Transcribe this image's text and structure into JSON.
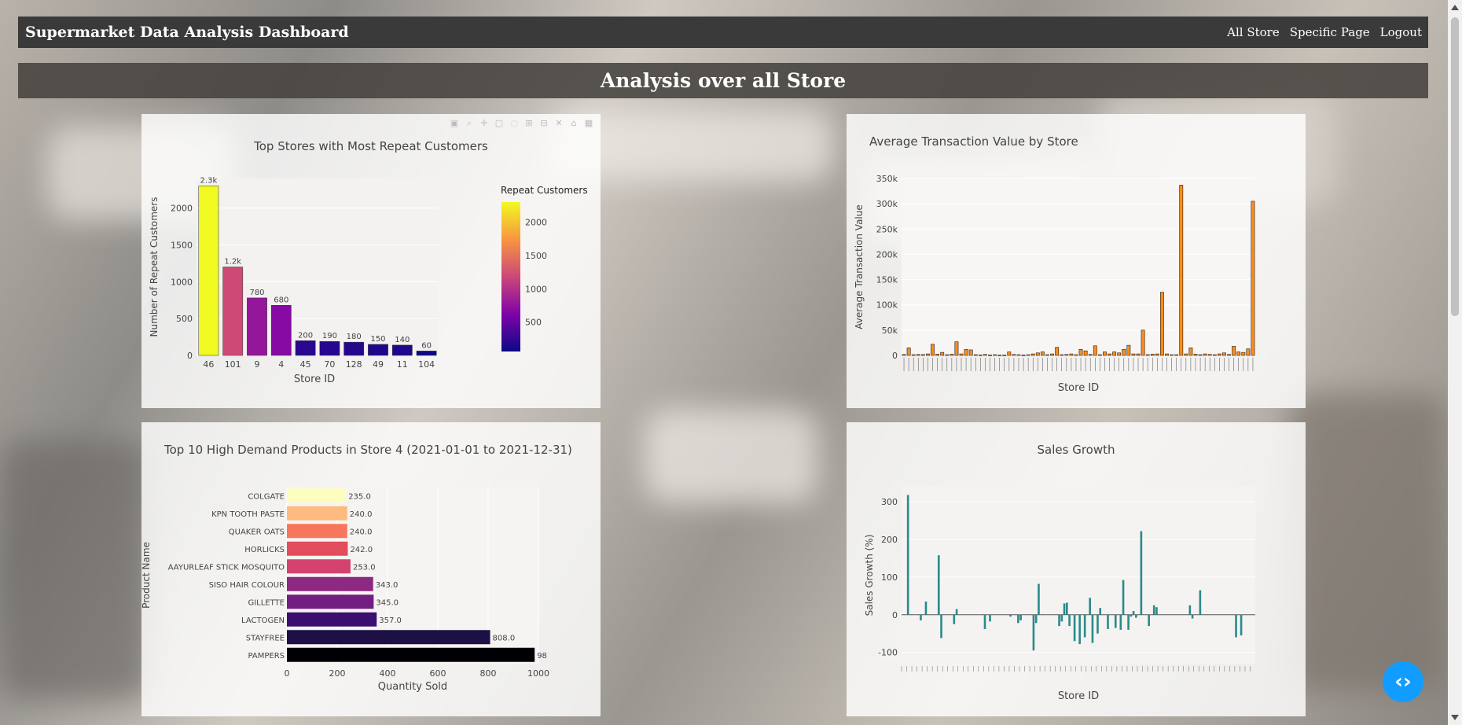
{
  "navbar": {
    "brand": "Supermarket Data Analysis Dashboard",
    "links": [
      "All Store",
      "Specific Page",
      "Logout"
    ]
  },
  "banner": {
    "title": "Analysis over all Store"
  },
  "colors": {
    "navbar": "#3a3a3a",
    "bar_orange": "#ff8c1a",
    "bar_teal": "#2a8a8a",
    "debug_button": "#119dff"
  },
  "icons": {
    "modebar": [
      "camera-icon",
      "zoom-icon",
      "pan-icon",
      "box-select-icon",
      "lasso-icon",
      "zoom-in-icon",
      "zoom-out-icon",
      "autoscale-icon",
      "reset-axes-icon",
      "plotly-logo-icon"
    ],
    "debug": "code-icon"
  },
  "chart_data": [
    {
      "type": "bar",
      "title": "Top Stores with Most Repeat Customers",
      "xlabel": "Store ID",
      "ylabel": "Number of Repeat Customers",
      "categories": [
        "46",
        "101",
        "9",
        "4",
        "45",
        "70",
        "128",
        "49",
        "11",
        "104"
      ],
      "values": [
        2300,
        1200,
        780,
        680,
        200,
        190,
        180,
        150,
        140,
        60
      ],
      "labels": [
        "2.3k",
        "1.2k",
        "780",
        "680",
        "200",
        "190",
        "180",
        "150",
        "140",
        "60"
      ],
      "ylim": [
        0,
        2400
      ],
      "yticks": [
        0,
        500,
        1000,
        1500,
        2000
      ],
      "colorbar": {
        "title": "Repeat Customers",
        "ticks": [
          500,
          1000,
          1500,
          2000
        ],
        "range": [
          60,
          2300
        ]
      }
    },
    {
      "type": "bar",
      "title": "Average Transaction Value by Store",
      "xlabel": "Store ID",
      "ylabel": "Average Transaction Value",
      "ylim": [
        0,
        350000
      ],
      "yticks": [
        0,
        50000,
        100000,
        150000,
        200000,
        250000,
        300000,
        350000
      ],
      "ytick_labels": [
        "0",
        "50k",
        "100k",
        "150k",
        "200k",
        "250k",
        "300k",
        "350k"
      ],
      "values": [
        2000,
        15000,
        1500,
        2000,
        1800,
        3000,
        22000,
        2500,
        6000,
        1500,
        2500,
        27000,
        3000,
        12000,
        11000,
        1500,
        1200,
        2000,
        1000,
        1500,
        1000,
        1000,
        7000,
        2000,
        1500,
        1000,
        1500,
        3000,
        5000,
        7000,
        1500,
        3000,
        16000,
        1500,
        2000,
        3000,
        1500,
        12000,
        9000,
        2000,
        19000,
        1500,
        7000,
        3000,
        7000,
        5000,
        12000,
        20000,
        3000,
        3000,
        50000,
        1500,
        2500,
        3000,
        125000,
        3000,
        1500,
        1500,
        337000,
        3000,
        15000,
        2500,
        1500,
        3000,
        2000,
        1500,
        3000,
        5000,
        2000,
        18000,
        7000,
        6000,
        13000,
        305000
      ]
    },
    {
      "type": "bar",
      "orientation": "horizontal",
      "title": "Top 10 High Demand Products in Store 4 (2021-01-01 to 2021-12-31)",
      "xlabel": "Quantity Sold",
      "ylabel": "Product Name",
      "categories": [
        "COLGATE",
        "KPN TOOTH PASTE",
        "QUAKER OATS",
        "HORLICKS",
        "AAYURLEAF STICK MOSQUITO",
        "SISO HAIR COLOUR",
        "GILLETTE",
        "LACTOGEN",
        "STAYFREE",
        "PAMPERS"
      ],
      "values": [
        235,
        240,
        240,
        242,
        253,
        343,
        345,
        357,
        808,
        985
      ],
      "labels": [
        "235.0",
        "240.0",
        "240.0",
        "242.0",
        "253.0",
        "343.0",
        "345.0",
        "357.0",
        "808.0",
        "98"
      ],
      "xlim": [
        0,
        1000
      ],
      "xticks": [
        0,
        200,
        400,
        600,
        800,
        1000
      ]
    },
    {
      "type": "bar",
      "title": "Sales Growth",
      "xlabel": "Store ID",
      "ylabel": "Sales Growth (%)",
      "ylim": [
        -130,
        340
      ],
      "yticks": [
        -100,
        0,
        100,
        200,
        300
      ],
      "values": [
        0,
        0,
        318,
        0,
        0,
        0,
        0,
        -15,
        0,
        35,
        0,
        0,
        0,
        0,
        158,
        -62,
        0,
        0,
        0,
        0,
        -25,
        15,
        0,
        0,
        0,
        0,
        0,
        0,
        0,
        0,
        0,
        0,
        -38,
        0,
        -18,
        0,
        0,
        0,
        0,
        0,
        0,
        0,
        -5,
        0,
        0,
        -22,
        -15,
        0,
        0,
        0,
        0,
        -95,
        -22,
        82,
        0,
        0,
        0,
        0,
        0,
        0,
        0,
        -30,
        -18,
        30,
        32,
        -30,
        0,
        -70,
        0,
        -78,
        0,
        -60,
        0,
        45,
        -75,
        0,
        -50,
        18,
        0,
        0,
        -38,
        0,
        0,
        -35,
        0,
        -40,
        92,
        0,
        -40,
        -5,
        10,
        -8,
        0,
        222,
        0,
        0,
        -30,
        0,
        25,
        20,
        0,
        0,
        0,
        0,
        0,
        0,
        0,
        0,
        0,
        0,
        0,
        0,
        25,
        -10,
        0,
        0,
        65,
        0,
        0,
        0,
        0,
        0,
        0,
        0,
        0,
        0,
        0,
        0,
        0,
        0,
        -60,
        0,
        -55,
        0,
        0,
        0,
        0,
        0
      ]
    }
  ]
}
